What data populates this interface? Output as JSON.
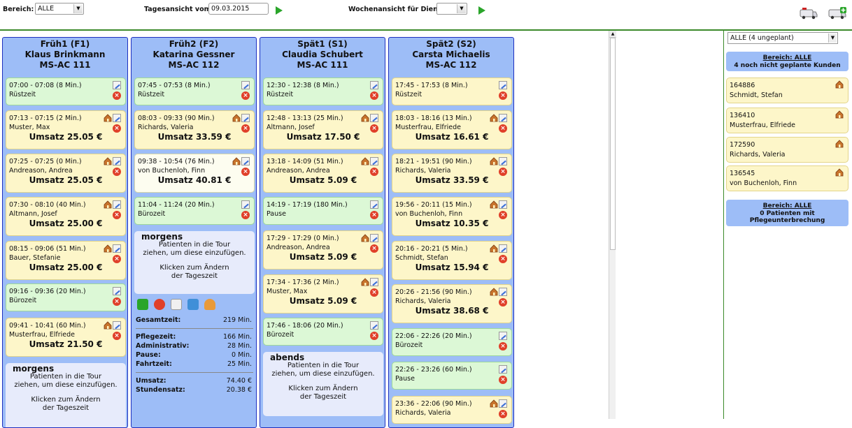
{
  "toolbar": {
    "bereich_label": "Bereich:",
    "bereich_value": "ALLE",
    "tagesansicht_label": "Tagesansicht vom",
    "date_value": "09.03.2015",
    "wochenansicht_label": "Wochenansicht für Dienst",
    "dienst_value": ""
  },
  "columns": [
    {
      "shift": "Früh1 (F1)",
      "name": "Klaus Brinkmann",
      "vehicle": "MS-AC 111",
      "cards": [
        {
          "time": "07:00 - 07:08 (8 Min.)",
          "who": "Rüstzeit",
          "sum": "",
          "color": "green",
          "house": false
        },
        {
          "time": "07:13 - 07:15 (2 Min.)",
          "who": "Muster, Max",
          "sum": "Umsatz 25.05 €",
          "color": "yellow",
          "house": true
        },
        {
          "time": "07:25 - 07:25 (0 Min.)",
          "who": "Andreason, Andrea",
          "sum": "Umsatz 25.05 €",
          "color": "yellow",
          "house": true
        },
        {
          "time": "07:30 - 08:10 (40 Min.)",
          "who": "Altmann, Josef",
          "sum": "Umsatz 25.00 €",
          "color": "yellow",
          "house": true
        },
        {
          "time": "08:15 - 09:06 (51 Min.)",
          "who": "Bauer, Stefanie",
          "sum": "Umsatz 25.00 €",
          "color": "yellow",
          "house": true
        },
        {
          "time": "09:16 - 09:36 (20 Min.)",
          "who": "Bürozeit",
          "sum": "",
          "color": "green",
          "house": false
        },
        {
          "time": "09:41 - 10:41 (60 Min.)",
          "who": "Musterfrau, Elfriede",
          "sum": "Umsatz 21.50 €",
          "color": "yellow",
          "house": true
        }
      ],
      "drop": {
        "title": "morgens",
        "text1": "Patienten in die Tour",
        "text2": "ziehen, um diese einzufügen.",
        "text3": "Klicken zum Ändern",
        "text4": "der Tageszeit"
      }
    },
    {
      "shift": "Früh2 (F2)",
      "name": "Katarina Gessner",
      "vehicle": "MS-AC 112",
      "cards": [
        {
          "time": "07:45 - 07:53 (8 Min.)",
          "who": "Rüstzeit",
          "sum": "",
          "color": "green",
          "house": false
        },
        {
          "time": "08:03 - 09:33 (90 Min.)",
          "who": "Richards, Valeria",
          "sum": "Umsatz 33.59 €",
          "color": "yellow",
          "house": true
        },
        {
          "time": "09:38 - 10:54 (76 Min.)",
          "who": "von Buchenloh, Finn",
          "sum": "Umsatz 40.81 €",
          "color": "white",
          "house": true
        },
        {
          "time": "11:04 - 11:24 (20 Min.)",
          "who": "Bürozeit",
          "sum": "",
          "color": "green",
          "house": false
        }
      ],
      "drop": {
        "title": "morgens",
        "text1": "Patienten in die Tour",
        "text2": "ziehen, um diese einzufügen.",
        "text3": "Klicken zum Ändern",
        "text4": "der Tageszeit"
      },
      "stats": {
        "gesamtzeit_label": "Gesamtzeit:",
        "gesamtzeit": "219 Min.",
        "pflegezeit_label": "Pflegezeit:",
        "pflegezeit": "166 Min.",
        "administrativ_label": "Administrativ:",
        "administrativ": "28 Min.",
        "pause_label": "Pause:",
        "pause": "0 Min.",
        "fahrtzeit_label": "Fahrtzeit:",
        "fahrtzeit": "25 Min.",
        "umsatz_label": "Umsatz:",
        "umsatz": "74.40 €",
        "stundensatz_label": "Stundensatz:",
        "stundensatz": "20.38 €"
      }
    },
    {
      "shift": "Spät1 (S1)",
      "name": "Claudia Schubert",
      "vehicle": "MS-AC 111",
      "cards": [
        {
          "time": "12:30 - 12:38 (8 Min.)",
          "who": "Rüstzeit",
          "sum": "",
          "color": "green",
          "house": false
        },
        {
          "time": "12:48 - 13:13 (25 Min.)",
          "who": "Altmann, Josef",
          "sum": "Umsatz 17.50 €",
          "color": "yellow",
          "house": true
        },
        {
          "time": "13:18 - 14:09 (51 Min.)",
          "who": "Andreason, Andrea",
          "sum": "Umsatz 5.09 €",
          "color": "yellow",
          "house": true
        },
        {
          "time": "14:19 - 17:19 (180 Min.)",
          "who": "Pause",
          "sum": "",
          "color": "green",
          "house": false
        },
        {
          "time": "17:29 - 17:29 (0 Min.)",
          "who": "Andreason, Andrea",
          "sum": "Umsatz 5.09 €",
          "color": "yellow",
          "house": true
        },
        {
          "time": "17:34 - 17:36 (2 Min.)",
          "who": "Muster, Max",
          "sum": "Umsatz 5.09 €",
          "color": "yellow",
          "house": true
        },
        {
          "time": "17:46 - 18:06 (20 Min.)",
          "who": "Bürozeit",
          "sum": "",
          "color": "green",
          "house": false
        }
      ],
      "drop": {
        "title": "abends",
        "text1": "Patienten in die Tour",
        "text2": "ziehen, um diese einzufügen.",
        "text3": "Klicken zum Ändern",
        "text4": "der Tageszeit"
      }
    },
    {
      "shift": "Spät2 (S2)",
      "name": "Carsta Michaelis",
      "vehicle": "MS-AC 112",
      "cards": [
        {
          "time": "17:45 - 17:53 (8 Min.)",
          "who": "Rüstzeit",
          "sum": "",
          "color": "yellow",
          "house": false
        },
        {
          "time": "18:03 - 18:16 (13 Min.)",
          "who": "Musterfrau, Elfriede",
          "sum": "Umsatz 16.61 €",
          "color": "yellow",
          "house": true
        },
        {
          "time": "18:21 - 19:51 (90 Min.)",
          "who": "Richards, Valeria",
          "sum": "Umsatz 33.59 €",
          "color": "yellow",
          "house": true
        },
        {
          "time": "19:56 - 20:11 (15 Min.)",
          "who": "von Buchenloh, Finn",
          "sum": "Umsatz 10.35 €",
          "color": "yellow",
          "house": true
        },
        {
          "time": "20:16 - 20:21 (5 Min.)",
          "who": "Schmidt, Stefan",
          "sum": "Umsatz 15.94 €",
          "color": "yellow",
          "house": true
        },
        {
          "time": "20:26 - 21:56 (90 Min.)",
          "who": "Richards, Valeria",
          "sum": "Umsatz 38.68 €",
          "color": "yellow",
          "house": true
        },
        {
          "time": "22:06 - 22:26 (20 Min.)",
          "who": "Bürozeit",
          "sum": "",
          "color": "green",
          "house": false
        },
        {
          "time": "22:26 - 23:26 (60 Min.)",
          "who": "Pause",
          "sum": "",
          "color": "green",
          "house": false
        },
        {
          "time": "23:36 - 22:06 (90 Min.)",
          "who": "Richards, Valeria",
          "sum": "",
          "color": "yellow",
          "house": true
        }
      ]
    }
  ],
  "right_panel": {
    "select_value": "ALLE (4 ungeplant)",
    "bereich_link": "Bereich: ALLE",
    "unplanned_text": "4 noch nicht geplante Kunden",
    "patients": [
      {
        "id": "164886",
        "name": "Schmidt, Stefan"
      },
      {
        "id": "136410",
        "name": "Musterfrau, Elfriede"
      },
      {
        "id": "172590",
        "name": "Richards, Valeria"
      },
      {
        "id": "136545",
        "name": "von Buchenloh, Finn"
      }
    ],
    "bereich_link2": "Bereich: ALLE",
    "interrupt_line1": "0 Patienten mit",
    "interrupt_line2": "Pflegeunterbrechung"
  },
  "colors": {
    "column_bg": "#9dbdf7",
    "column_border": "#1d2fbf",
    "card_green": "#dcf8d6",
    "card_yellow": "#fdf6c9",
    "accent_green": "#2aa52a"
  }
}
